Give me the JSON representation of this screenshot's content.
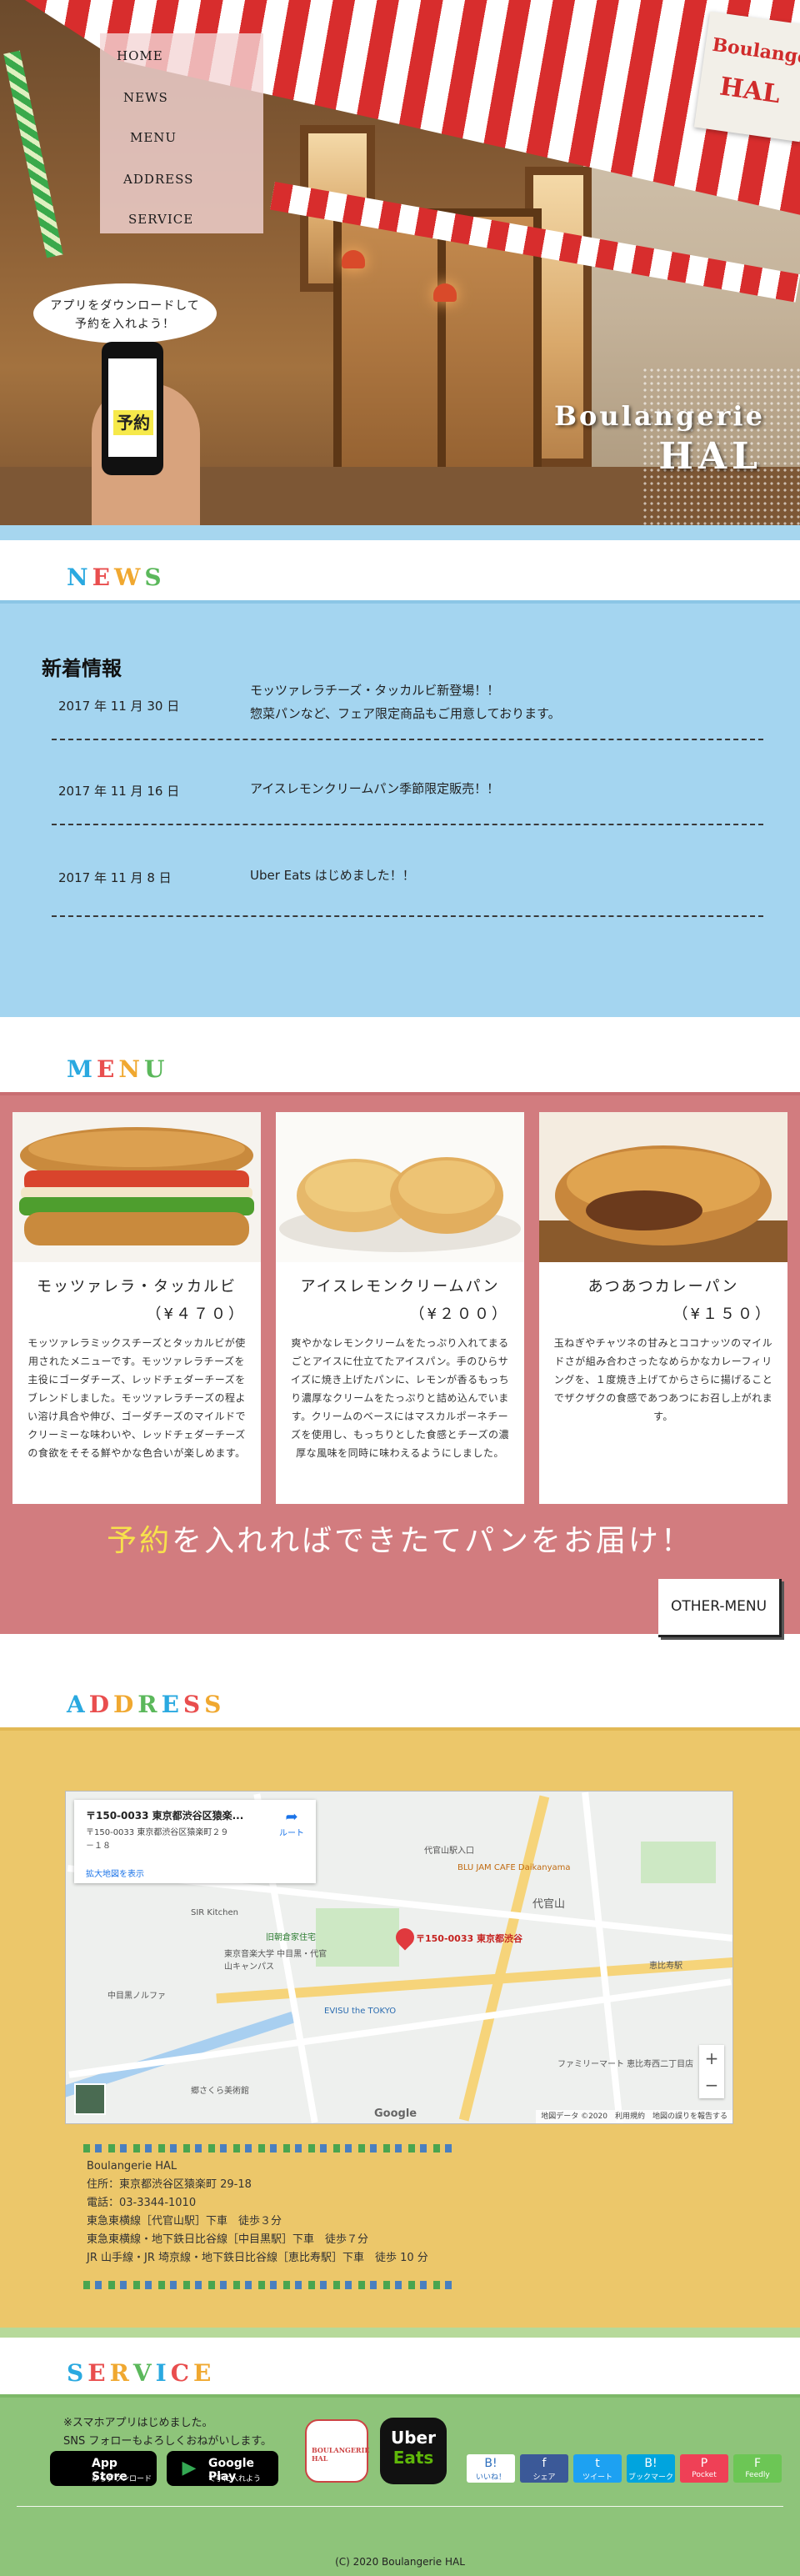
{
  "nav": {
    "items": [
      {
        "label": "HOME"
      },
      {
        "label": "NEWS"
      },
      {
        "label": "MENU"
      },
      {
        "label": "ADDRESS"
      },
      {
        "label": "SERVICE"
      }
    ]
  },
  "logo": {
    "line1": "Boulanger",
    "line2": "HAL"
  },
  "hero": {
    "bubble_line1": "アプリをダウンロードして",
    "bubble_line2": "予約を入れよう！",
    "phone_button": "予約",
    "title_line1": "Boulangerie",
    "title_line2": "HAL"
  },
  "sections": {
    "news": [
      "N",
      "E",
      "W",
      "S"
    ],
    "menu": [
      "M",
      "E",
      "N",
      "U"
    ],
    "address": [
      "A",
      "D",
      "D",
      "R",
      "E",
      "S",
      "S"
    ],
    "service": [
      "S",
      "E",
      "R",
      "V",
      "I",
      "C",
      "E"
    ],
    "colors": [
      "#2aa9e0",
      "#e94e4e",
      "#f0a830",
      "#5bb85b"
    ]
  },
  "news": {
    "title": "新着情報",
    "items": [
      {
        "date": "2017 年 11 月 30 日",
        "line1": "モッツァレラチーズ・タッカルビ新登場！！",
        "line2": "惣菜パンなど、フェア限定商品もご用意しております。"
      },
      {
        "date": "2017 年 11 月 16 日",
        "line1": "アイスレモンクリームパン季節限定販売！！",
        "line2": ""
      },
      {
        "date": "2017 年 11 月 8 日",
        "line1": "Uber Eats はじめました！！",
        "line2": ""
      }
    ]
  },
  "menu": {
    "items": [
      {
        "name": "モッツァレラ・タッカルビ",
        "price": "（¥４７０）",
        "desc": "モッツァレラミックスチーズとタッカルビが使用されたメニューです。モッツァレラチーズを主役にゴーダチーズ、レッドチェダーチーズをブレンドしました。モッツァレラチーズの程よい溶け具合や伸び、ゴーダチーズのマイルドでクリーミーな味わいや、レッドチェダーチーズの食欲をそそる鮮やかな色合いが楽しめます。"
      },
      {
        "name": "アイスレモンクリームパン",
        "price": "（¥２００）",
        "desc": "爽やかなレモンクリームをたっぷり入れてまるごとアイスに仕立てたアイスパン。手のひらサイズに焼き上げたパンに、レモンが香るもっちり濃厚なクリームをたっぷりと詰め込んでいます。クリームのベースにはマスカルポーネチーズを使用し、もっちりとした食感とチーズの濃厚な風味を同時に味わえるようにしました。"
      },
      {
        "name": "あつあつカレーパン",
        "price": "（¥１５０）",
        "desc": "玉ねぎやチャツネの甘みとココナッツのマイルドさが組み合わさったなめらかなカレーフィリングを、１度焼き上げてからさらに揚げることでザクザクの食感であつあつにお召し上がれます。"
      }
    ],
    "slogan_highlight": "予約",
    "slogan_rest": "を入れればできたてパンをお届け！",
    "other_button": "OTHER-MENU"
  },
  "address": {
    "map": {
      "card_title": "〒150-0033 東京都渋谷区猿楽...",
      "card_address_1": "〒150-0033 東京都渋谷区猿楽町２９",
      "card_address_2": "－１８",
      "card_link": "拡大地図を表示",
      "directions": "ルート",
      "pin_label": "〒150-0033 東京都渋谷",
      "labels": [
        "代官山駅入口",
        "BLU JAM CAFE Daikanyama",
        "代官山",
        "旧朝倉家住宅",
        "EVISU the TOKYO",
        "ファミリーマート 恵比寿西二丁目店",
        "SIR Kitchen",
        "東京音楽大学 中目黒・代官山キャンパス",
        "中目黒ノルファ",
        "郷さくら美術館",
        "恵比寿駅"
      ],
      "zoom_in": "+",
      "zoom_out": "−",
      "google": "Google",
      "footer": "地図データ ©2020　利用規約　地図の誤りを報告する"
    },
    "lines": [
      "Boulangerie HAL",
      "住所：東京都渋谷区猿楽町 29-18",
      "電話：03-3344-1010",
      "東急東横線［代官山駅］下車　徒歩３分",
      "東急東横線・地下鉄日比谷線［中目黒駅］下車　徒歩７分",
      "JR 山手線・JR 埼京線・地下鉄日比谷線［恵比寿駅］下車　徒歩 10 分"
    ]
  },
  "service": {
    "line1": "※スマホアプリはじめました。",
    "line2": "SNS フォローもよろしくおねがいします。",
    "appstore_small": "App Storeから",
    "appstore_big": "App Store",
    "appstore_sub": "からダウンロード",
    "googleplay_small": "GET IT ON",
    "googleplay_big": "Google Play",
    "googleplay_sub": "で手に入れよう",
    "app_hal": "BOULANGERIE HAL",
    "uber_1": "Uber",
    "uber_2": "Eats",
    "share": [
      {
        "glyph": "B!",
        "label": "いいね！",
        "color": "#2c6ebd"
      },
      {
        "glyph": "f",
        "label": "シェア",
        "color": "#3b5998"
      },
      {
        "glyph": "t",
        "label": "ツイート",
        "color": "#1da1f2"
      },
      {
        "glyph": "B!",
        "label": "ブックマーク",
        "color": "#00a4de"
      },
      {
        "glyph": "P",
        "label": "Pocket",
        "color": "#ef4056"
      },
      {
        "glyph": "F",
        "label": "Feedly",
        "color": "#6cc655"
      }
    ],
    "copyright": "(C) 2020 Boulangerie HAL"
  }
}
